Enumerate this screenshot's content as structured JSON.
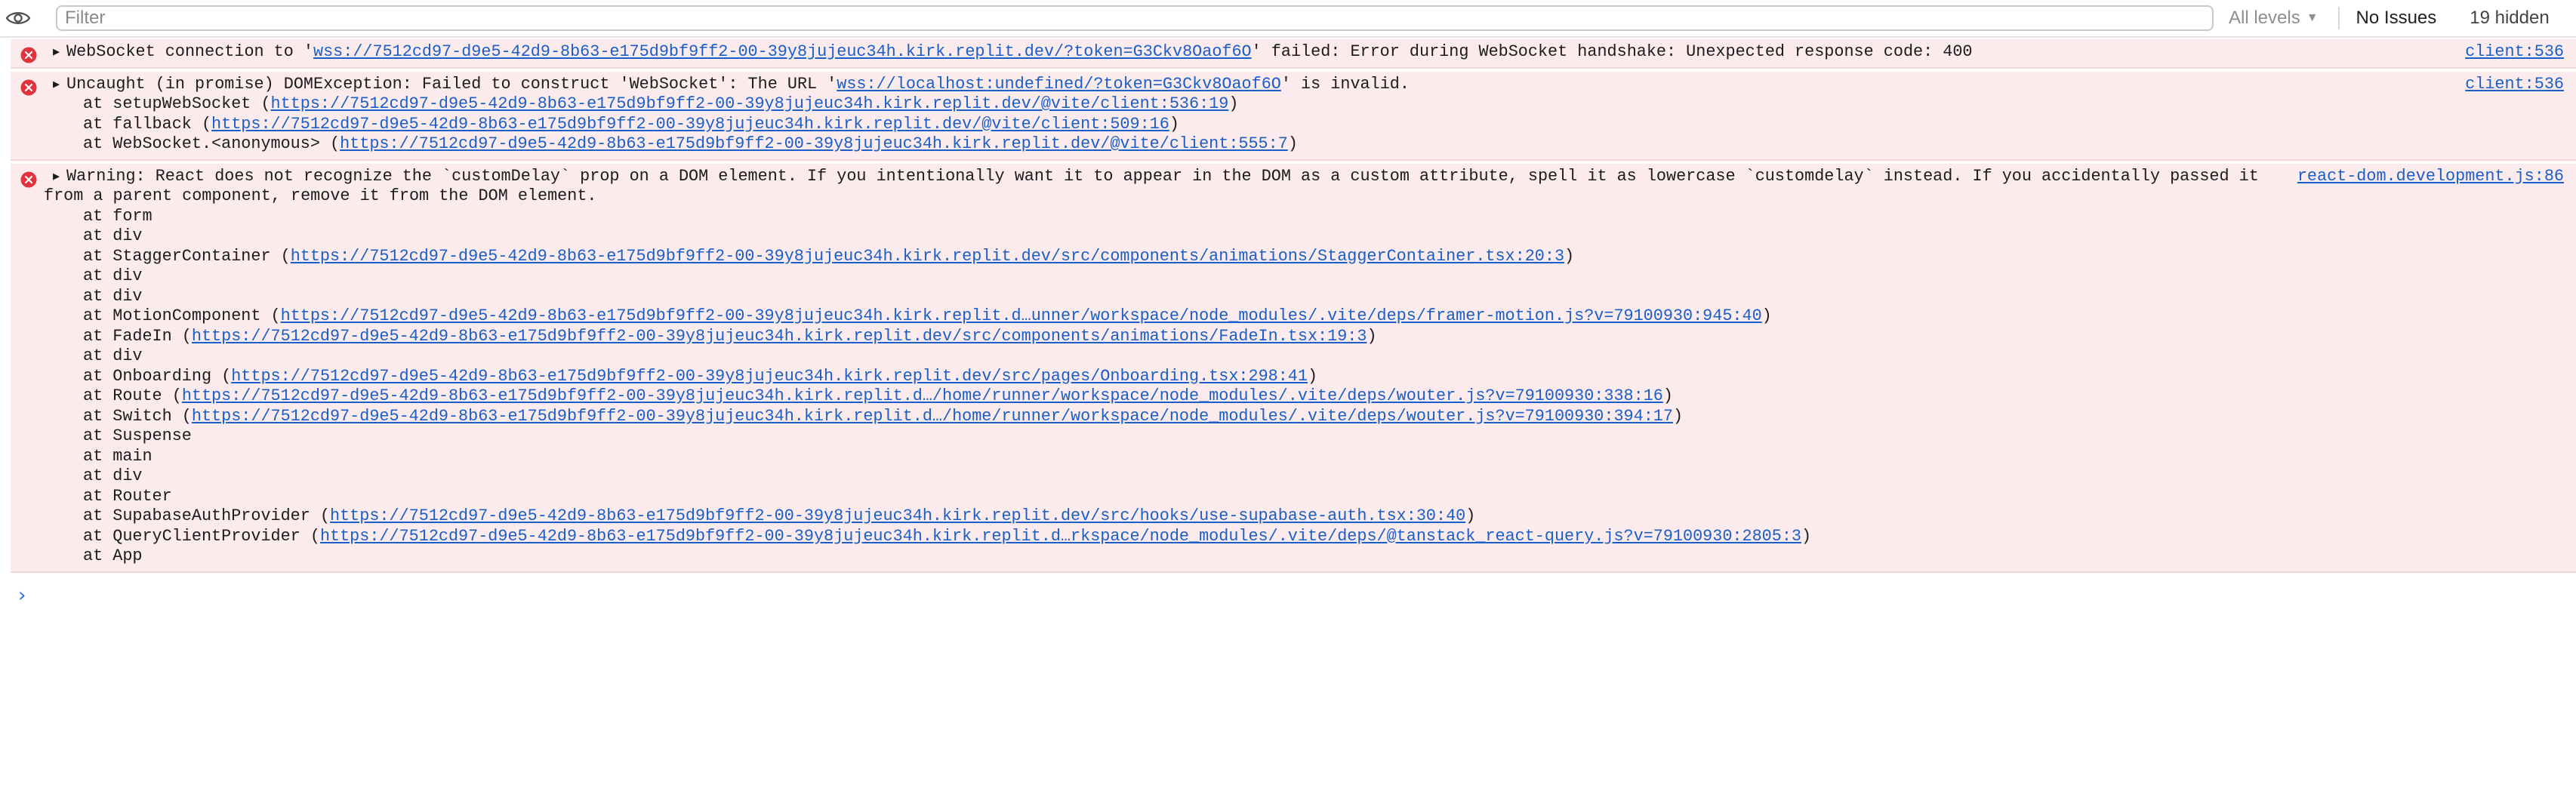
{
  "toolbar": {
    "filter_placeholder": "Filter",
    "levels_label": "All levels",
    "issues_label": "No Issues",
    "hidden_label": "19 hidden"
  },
  "messages": [
    {
      "line1_text_a": "WebSocket connection to '",
      "line1_link": "wss://7512cd97-d9e5-42d9-8b63-e175d9bf9ff2-00-39y8jujeuc34h.kirk.replit.dev/?token=G3Ckv8Oaof6O",
      "line1_text_b": "' failed: Error during WebSocket handshake: Unexpected response code: 400",
      "source": "client:536"
    },
    {
      "line1_text_a": "Uncaught (in promise) DOMException: Failed to construct 'WebSocket': The URL '",
      "line1_link": "wss://localhost:undefined/?token=G3Ckv8Oaof6O",
      "line1_text_b": "' is invalid.",
      "source": "client:536",
      "frames": [
        {
          "prefix": "at setupWebSocket (",
          "link": "https://7512cd97-d9e5-42d9-8b63-e175d9bf9ff2-00-39y8jujeuc34h.kirk.replit.dev/@vite/client:536:19",
          "suffix": ")"
        },
        {
          "prefix": "at fallback (",
          "link": "https://7512cd97-d9e5-42d9-8b63-e175d9bf9ff2-00-39y8jujeuc34h.kirk.replit.dev/@vite/client:509:16",
          "suffix": ")"
        },
        {
          "prefix": "at WebSocket.<anonymous> (",
          "link": "https://7512cd97-d9e5-42d9-8b63-e175d9bf9ff2-00-39y8jujeuc34h.kirk.replit.dev/@vite/client:555:7",
          "suffix": ")"
        }
      ]
    },
    {
      "line1_text_a": "Warning: React does not recognize the `customDelay` prop on a DOM element. If you intentionally want it to appear in the DOM as a custom attribute, spell it as lowercase `customdelay` instead. If you accidentally passed it",
      "continuation": "from a parent component, remove it from the DOM element.",
      "source": "react-dom.development.js:86",
      "frames": [
        {
          "prefix": "at form"
        },
        {
          "prefix": "at div"
        },
        {
          "prefix": "at StaggerContainer (",
          "link": "https://7512cd97-d9e5-42d9-8b63-e175d9bf9ff2-00-39y8jujeuc34h.kirk.replit.dev/src/components/animations/StaggerContainer.tsx:20:3",
          "suffix": ")"
        },
        {
          "prefix": "at div"
        },
        {
          "prefix": "at div"
        },
        {
          "prefix": "at MotionComponent (",
          "link": "https://7512cd97-d9e5-42d9-8b63-e175d9bf9ff2-00-39y8jujeuc34h.kirk.replit.d…unner/workspace/node_modules/.vite/deps/framer-motion.js?v=79100930:945:40",
          "suffix": ")"
        },
        {
          "prefix": "at FadeIn (",
          "link": "https://7512cd97-d9e5-42d9-8b63-e175d9bf9ff2-00-39y8jujeuc34h.kirk.replit.dev/src/components/animations/FadeIn.tsx:19:3",
          "suffix": ")"
        },
        {
          "prefix": "at div"
        },
        {
          "prefix": "at Onboarding (",
          "link": "https://7512cd97-d9e5-42d9-8b63-e175d9bf9ff2-00-39y8jujeuc34h.kirk.replit.dev/src/pages/Onboarding.tsx:298:41",
          "suffix": ")"
        },
        {
          "prefix": "at Route (",
          "link": "https://7512cd97-d9e5-42d9-8b63-e175d9bf9ff2-00-39y8jujeuc34h.kirk.replit.d…/home/runner/workspace/node_modules/.vite/deps/wouter.js?v=79100930:338:16",
          "suffix": ")"
        },
        {
          "prefix": "at Switch (",
          "link": "https://7512cd97-d9e5-42d9-8b63-e175d9bf9ff2-00-39y8jujeuc34h.kirk.replit.d…/home/runner/workspace/node_modules/.vite/deps/wouter.js?v=79100930:394:17",
          "suffix": ")"
        },
        {
          "prefix": "at Suspense"
        },
        {
          "prefix": "at main"
        },
        {
          "prefix": "at div"
        },
        {
          "prefix": "at Router"
        },
        {
          "prefix": "at SupabaseAuthProvider (",
          "link": "https://7512cd97-d9e5-42d9-8b63-e175d9bf9ff2-00-39y8jujeuc34h.kirk.replit.dev/src/hooks/use-supabase-auth.tsx:30:40",
          "suffix": ")"
        },
        {
          "prefix": "at QueryClientProvider (",
          "link": "https://7512cd97-d9e5-42d9-8b63-e175d9bf9ff2-00-39y8jujeuc34h.kirk.replit.d…rkspace/node_modules/.vite/deps/@tanstack_react-query.js?v=79100930:2805:3",
          "suffix": ")"
        },
        {
          "prefix": "at App"
        }
      ]
    }
  ],
  "prompt_symbol": "›",
  "icons": {
    "eye": "eye-icon",
    "error": "error-circle-icon",
    "disclosure": "disclosure-triangle-icon",
    "levels_caret": "chevron-down-icon"
  },
  "colors": {
    "error_background": "#fcebec",
    "error_icon": "#e0333d",
    "link": "#1a5fc9",
    "prompt": "#2a6de4"
  }
}
